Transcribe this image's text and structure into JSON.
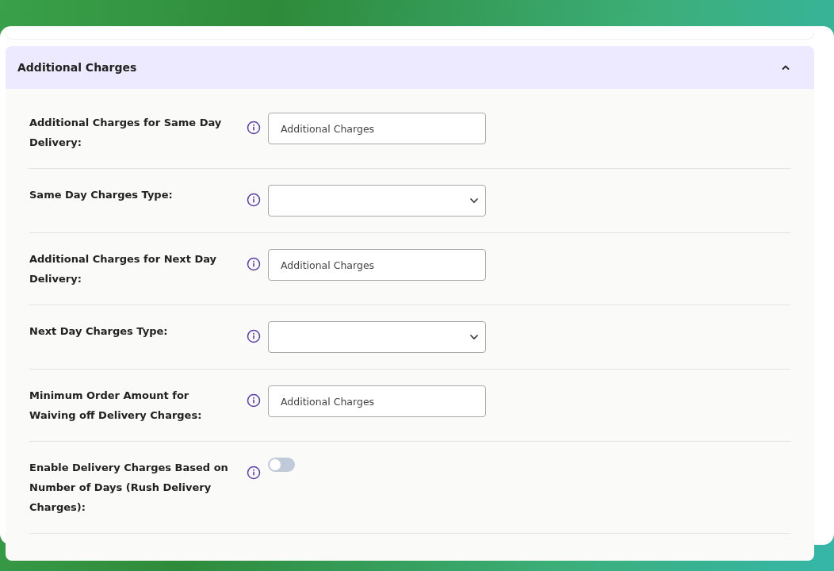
{
  "section": {
    "title": "Additional Charges",
    "expanded": true
  },
  "fields": [
    {
      "kind": "text",
      "label": "Additional Charges for Same Day Delivery:",
      "placeholder": "Additional Charges"
    },
    {
      "kind": "select",
      "label": "Same Day Charges Type:"
    },
    {
      "kind": "text",
      "label": "Additional Charges for Next Day Delivery:",
      "placeholder": "Additional Charges"
    },
    {
      "kind": "select",
      "label": "Next Day Charges Type:"
    },
    {
      "kind": "text",
      "label": "Minimum Order Amount for Waiving off Delivery Charges:",
      "placeholder": "Additional Charges"
    },
    {
      "kind": "toggle",
      "label": "Enable Delivery Charges Based on Number of Days (Rush Delivery Charges):",
      "on": false
    }
  ]
}
